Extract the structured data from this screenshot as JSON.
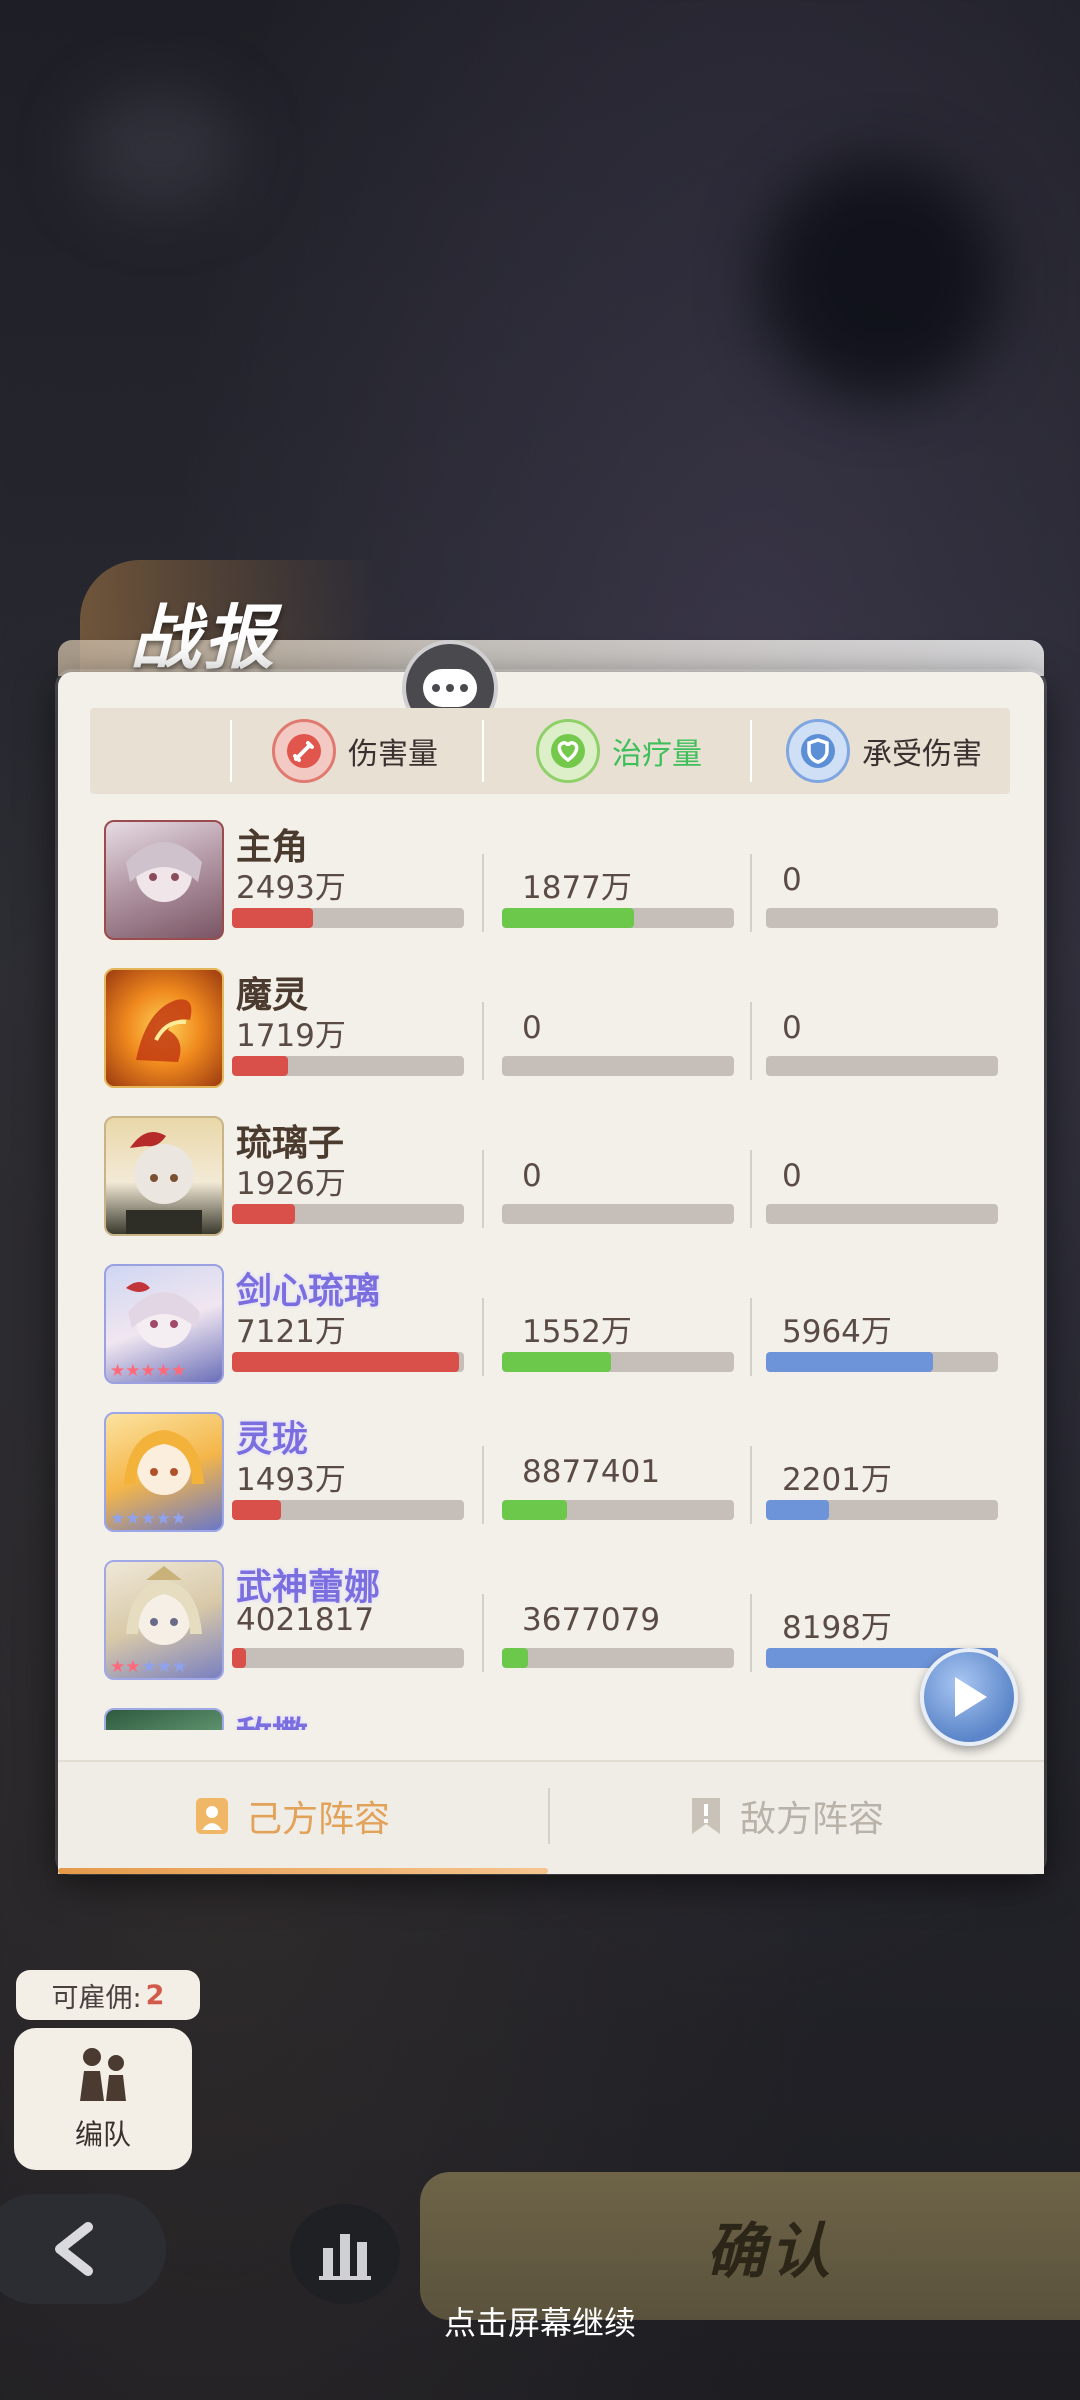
{
  "title": "战报",
  "headers": {
    "damage": "伤害量",
    "healing": "治疗量",
    "taken": "承受伤害"
  },
  "colors": {
    "damage": "#d9504a",
    "healing": "#6cc84b",
    "taken": "#6d93d8"
  },
  "rows": [
    {
      "name": "主角",
      "damage": "2493万",
      "healing": "1877万",
      "taken": "0",
      "damage_pct": 35,
      "healing_pct": 57,
      "taken_pct": 0,
      "purple": false
    },
    {
      "name": "魔灵",
      "damage": "1719万",
      "healing": "0",
      "taken": "0",
      "damage_pct": 24,
      "healing_pct": 0,
      "taken_pct": 0,
      "purple": false
    },
    {
      "name": "琉璃子",
      "damage": "1926万",
      "healing": "0",
      "taken": "0",
      "damage_pct": 27,
      "healing_pct": 0,
      "taken_pct": 0,
      "purple": false
    },
    {
      "name": "剑心琉璃",
      "damage": "7121万",
      "healing": "1552万",
      "taken": "5964万",
      "damage_pct": 98,
      "healing_pct": 47,
      "taken_pct": 72,
      "purple": true
    },
    {
      "name": "灵珑",
      "damage": "1493万",
      "healing": "8877401",
      "taken": "2201万",
      "damage_pct": 21,
      "healing_pct": 28,
      "taken_pct": 27,
      "purple": true
    },
    {
      "name": "武神蕾娜",
      "damage": "4021817",
      "healing": "3677079",
      "taken": "8198万",
      "damage_pct": 6,
      "healing_pct": 11,
      "taken_pct": 100,
      "purple": true
    },
    {
      "name": "敌撒",
      "damage": "",
      "healing": "",
      "taken": "",
      "damage_pct": 0,
      "healing_pct": 0,
      "taken_pct": 0,
      "purple": true
    }
  ],
  "tabs": {
    "ally": "己方阵容",
    "enemy": "敌方阵容"
  },
  "hire": {
    "label": "可雇佣:",
    "count": "2"
  },
  "formation_label": "编队",
  "confirm_label": "确认",
  "continue_hint": "点击屏幕继续"
}
